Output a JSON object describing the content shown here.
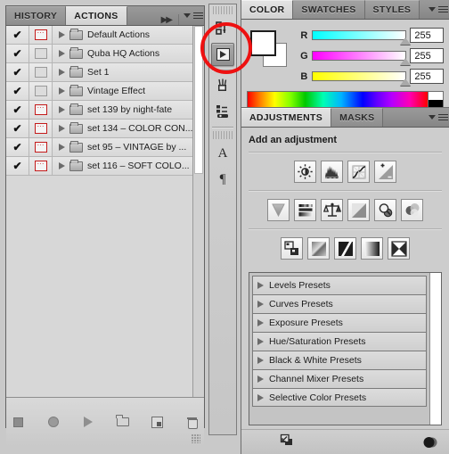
{
  "app": "Adobe Photoshop CS5 panels",
  "actions_panel": {
    "tabs": [
      {
        "label": "HISTORY",
        "active": false
      },
      {
        "label": "ACTIONS",
        "active": true
      }
    ],
    "collapse_icon": "double-arrow-right-icon",
    "menu_icon": "panel-menu-icon",
    "rows": [
      {
        "enabled": "✔",
        "dialog": true,
        "name": "Default Actions"
      },
      {
        "enabled": "✔",
        "dialog": false,
        "name": "Quba HQ Actions"
      },
      {
        "enabled": "✔",
        "dialog": false,
        "name": "Set 1"
      },
      {
        "enabled": "✔",
        "dialog": false,
        "name": "Vintage Effect"
      },
      {
        "enabled": "✔",
        "dialog": true,
        "name": "set 139 by night-fate"
      },
      {
        "enabled": "✔",
        "dialog": true,
        "name": "set 134 – COLOR CON..."
      },
      {
        "enabled": "✔",
        "dialog": true,
        "name": "set 95 – VINTAGE  by ..."
      },
      {
        "enabled": "✔",
        "dialog": true,
        "name": "set 116 – SOFT COLO..."
      }
    ],
    "footer_buttons": [
      {
        "name": "stop-playing-button",
        "icon": "stop-square-icon"
      },
      {
        "name": "begin-recording-button",
        "icon": "record-circle-icon"
      },
      {
        "name": "play-selection-button",
        "icon": "play-triangle-icon"
      },
      {
        "name": "create-new-set-button",
        "icon": "new-folder-icon"
      },
      {
        "name": "create-new-action-button",
        "icon": "new-action-icon"
      },
      {
        "name": "delete-button",
        "icon": "trash-icon"
      }
    ]
  },
  "dock": {
    "buttons": [
      {
        "name": "history-icon",
        "selected": false
      },
      {
        "name": "actions-play-icon",
        "selected": true
      },
      {
        "name": "brush-preset-icon",
        "selected": false
      },
      {
        "name": "clone-source-icon",
        "selected": false
      },
      {
        "name": "character-icon",
        "label": "A",
        "selected": false
      },
      {
        "name": "paragraph-icon",
        "label": "¶",
        "selected": false
      }
    ]
  },
  "color_panel": {
    "tabs": [
      {
        "label": "COLOR",
        "active": true
      },
      {
        "label": "SWATCHES",
        "active": false
      },
      {
        "label": "STYLES",
        "active": false
      }
    ],
    "menu_icon": "panel-menu-icon",
    "foreground_color": "#ffffff",
    "background_color": "#ffffff",
    "sliders": [
      {
        "label": "R",
        "value": "255",
        "from": "#00ffff",
        "to": "#ffffff"
      },
      {
        "label": "G",
        "value": "255",
        "from": "#ff00ff",
        "to": "#ffffff"
      },
      {
        "label": "B",
        "value": "255",
        "from": "#ffff00",
        "to": "#ffffff"
      }
    ],
    "ramp_name": "color-spectrum-ramp"
  },
  "adjustments_panel": {
    "tabs": [
      {
        "label": "ADJUSTMENTS",
        "active": true
      },
      {
        "label": "MASKS",
        "active": false
      }
    ],
    "menu_icon": "panel-menu-icon",
    "heading": "Add an adjustment",
    "icon_rows": [
      [
        {
          "name": "brightness-contrast-icon"
        },
        {
          "name": "levels-icon"
        },
        {
          "name": "curves-icon"
        },
        {
          "name": "exposure-icon"
        }
      ],
      [
        {
          "name": "vibrance-icon"
        },
        {
          "name": "hue-saturation-icon"
        },
        {
          "name": "color-balance-icon"
        },
        {
          "name": "black-and-white-icon"
        },
        {
          "name": "photo-filter-icon"
        },
        {
          "name": "channel-mixer-icon"
        }
      ],
      [
        {
          "name": "invert-icon"
        },
        {
          "name": "posterize-icon"
        },
        {
          "name": "threshold-icon"
        },
        {
          "name": "gradient-map-icon"
        },
        {
          "name": "selective-color-icon"
        }
      ]
    ],
    "presets": [
      "Levels Presets",
      "Curves Presets",
      "Exposure Presets",
      "Hue/Saturation Presets",
      "Black & White Presets",
      "Channel Mixer Presets",
      "Selective Color Presets"
    ],
    "footer": {
      "expand_icon": "expand-view-icon",
      "delete_icon": "delete-adjustment-layer-icon"
    }
  },
  "annotation": {
    "shape": "red-ellipse-highlight",
    "color": "#ee1111",
    "targets": "actions-play-icon"
  }
}
